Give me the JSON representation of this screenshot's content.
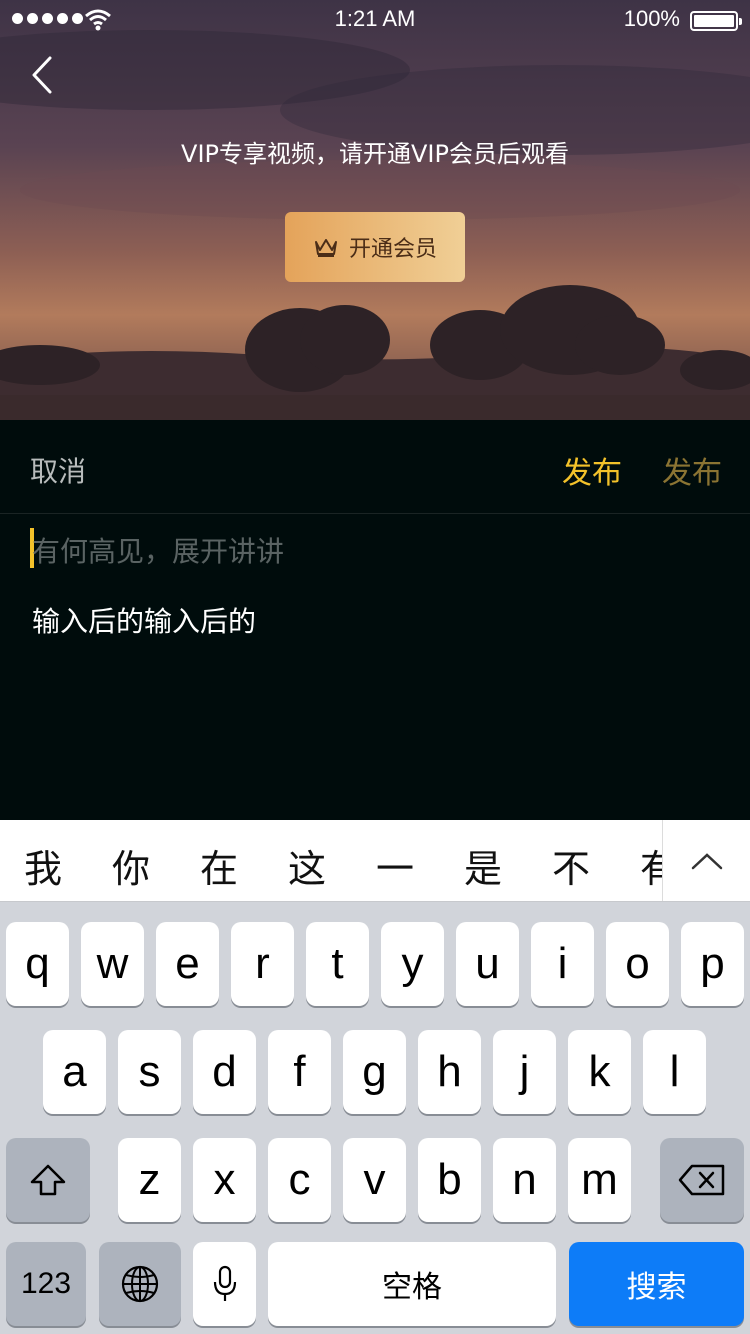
{
  "status_bar": {
    "time": "1:21 AM",
    "battery": "100%"
  },
  "hero": {
    "message": "VIP专享视频，请开通VIP会员后观看",
    "open_vip_label": "开通会员",
    "icons": [
      "back-arrow-icon",
      "crown-icon"
    ]
  },
  "editor": {
    "cancel_label": "取消",
    "publish_label": "发布",
    "publish_label_2": "发布",
    "placeholder": "有何高见，展开讲讲",
    "typed_text": "输入后的输入后的",
    "accent_color": "#f3c22a"
  },
  "candidates": [
    "我",
    "你",
    "在",
    "这",
    "一",
    "是",
    "不",
    "有"
  ],
  "keyboard": {
    "row1": [
      "q",
      "w",
      "e",
      "r",
      "t",
      "y",
      "u",
      "i",
      "o",
      "p"
    ],
    "row2": [
      "a",
      "s",
      "d",
      "f",
      "g",
      "h",
      "j",
      "k",
      "l"
    ],
    "row3": [
      "z",
      "x",
      "c",
      "v",
      "b",
      "n",
      "m"
    ],
    "numbers_label": "123",
    "space_label": "空格",
    "search_label": "搜索",
    "search_color": "#0d7cf8"
  }
}
